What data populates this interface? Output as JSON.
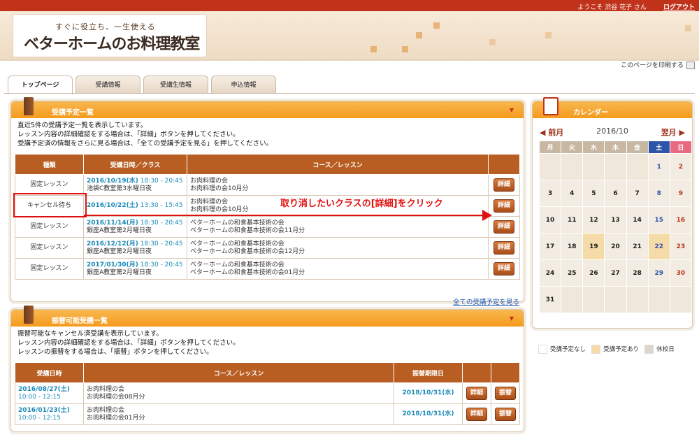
{
  "topbar": {
    "welcome": "ようこそ 渋谷 花子 さん",
    "logout": "ログアウト"
  },
  "brand": {
    "tagline": "すぐに役立ち、一生使える",
    "name": "ベターホームのお料理教室"
  },
  "print_label": "このページを印刷する",
  "tabs": [
    "トップページ",
    "受講情報",
    "受講生情報",
    "申込情報"
  ],
  "upcoming": {
    "title": "受講予定一覧",
    "intro": [
      "直近5件の受講予定一覧を表示しています。",
      "レッスン内容の詳細確認をする場合は、「詳細」ボタンを押してください。",
      "受講予定済の情報をさらに見る場合は、「全ての受講予定を見る」を押してください。"
    ],
    "headers": [
      "種類",
      "受講日時／クラス",
      "コース／レッスン"
    ],
    "rows": [
      {
        "kind": "固定レッスン",
        "date": "2016/10/19(水)",
        "time": "18:30 - 20:45",
        "class": "池袋C教室第3水曜日夜",
        "course": "お肉料理の会",
        "lesson": "お肉料理の会10月分",
        "button": "詳細"
      },
      {
        "kind": "キャンセル待ち",
        "date": "2016/10/22(土)",
        "time": "13:30 - 15:45",
        "class": "",
        "course": "お肉料理の会",
        "lesson": "お肉料理の会10月分",
        "button": "詳細"
      },
      {
        "kind": "固定レッスン",
        "date": "2016/11/14(月)",
        "time": "18:30 - 20:45",
        "class": "銀座A教室第2月曜日夜",
        "course": "ベターホームの和食基本技術の会",
        "lesson": "ベターホームの和食基本技術の会11月分",
        "button": "詳細"
      },
      {
        "kind": "固定レッスン",
        "date": "2016/12/12(月)",
        "time": "18:30 - 20:45",
        "class": "銀座A教室第2月曜日夜",
        "course": "ベターホームの和食基本技術の会",
        "lesson": "ベターホームの和食基本技術の会12月分",
        "button": "詳細"
      },
      {
        "kind": "固定レッスン",
        "date": "2017/01/30(月)",
        "time": "18:30 - 20:45",
        "class": "銀座A教室第2月曜日夜",
        "course": "ベターホームの和食基本技術の会",
        "lesson": "ベターホームの和食基本技術の会01月分",
        "button": "詳細"
      }
    ],
    "view_all": "全ての受講予定を見る",
    "annotation": "取り消したいクラスの[詳細]をクリック"
  },
  "transfer": {
    "title": "振替可能受講一覧",
    "intro": [
      "振替可能なキャンセル済受講を表示しています。",
      "レッスン内容の詳細確認をする場合は、「詳細」ボタンを押してください。",
      "レッスンの振替をする場合は、「振替」ボタンを押してください。"
    ],
    "headers": [
      "受講日時",
      "コース／レッスン",
      "振替期限日"
    ],
    "rows": [
      {
        "date": "2016/08/27(土)",
        "time": "10:00 - 12:15",
        "course": "お肉料理の会",
        "lesson": "お肉料理の会08月分",
        "deadline": "2018/10/31(水)",
        "detail": "詳細",
        "transfer": "振替"
      },
      {
        "date": "2016/01/23(土)",
        "time": "10:00 - 12:15",
        "course": "お肉料理の会",
        "lesson": "お肉料理の会01月分",
        "deadline": "2018/10/31(水)",
        "detail": "詳細",
        "transfer": "振替"
      }
    ]
  },
  "calendar": {
    "title": "カレンダー",
    "prev": "前月",
    "current": "2016/10",
    "next": "翌月",
    "weekdays": [
      "月",
      "火",
      "水",
      "木",
      "金",
      "土",
      "日"
    ],
    "weeks": [
      [
        "",
        "",
        "",
        "",
        "",
        "1",
        "2"
      ],
      [
        "3",
        "4",
        "5",
        "6",
        "7",
        "8",
        "9"
      ],
      [
        "10",
        "11",
        "12",
        "13",
        "14",
        "15",
        "16"
      ],
      [
        "17",
        "18",
        "19",
        "20",
        "21",
        "22",
        "23"
      ],
      [
        "24",
        "25",
        "26",
        "27",
        "28",
        "29",
        "30"
      ],
      [
        "31",
        "",
        "",
        "",
        "",
        "",
        ""
      ]
    ],
    "lesson_days": [
      "19",
      "22"
    ],
    "legend": [
      "受講予定なし",
      "受講予定あり",
      "休校日"
    ],
    "colors": {
      "none": "#ffffff",
      "has": "#f5dba8",
      "closed": "#dcd6cc"
    }
  }
}
